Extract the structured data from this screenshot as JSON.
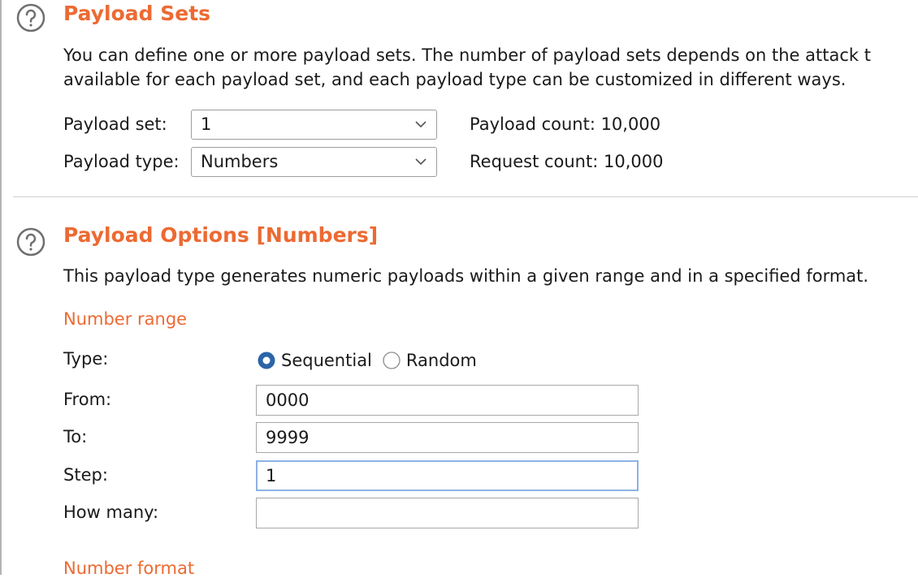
{
  "payload_sets": {
    "title": "Payload Sets",
    "description_line1": "You can define one or more payload sets. The number of payload sets depends on the attack t",
    "description_line2": "available for each payload set, and each payload type can be customized in different ways.",
    "payload_set_label": "Payload set:",
    "payload_set_value": "1",
    "payload_type_label": "Payload type:",
    "payload_type_value": "Numbers",
    "payload_count": "Payload count: 10,000",
    "request_count": "Request count: 10,000"
  },
  "payload_options": {
    "title": "Payload Options [Numbers]",
    "description": "This payload type generates numeric payloads within a given range and in a specified format.",
    "number_range_heading": "Number range",
    "type_label": "Type:",
    "type_options": [
      "Sequential",
      "Random"
    ],
    "type_selected": "Sequential",
    "from_label": "From:",
    "from_value": "0000",
    "to_label": "To:",
    "to_value": "9999",
    "step_label": "Step:",
    "step_value": "1",
    "how_many_label": "How many:",
    "how_many_value": "",
    "number_format_heading": "Number format"
  },
  "colors": {
    "accent": "#ec6a33",
    "radio_selected": "#2b65a7",
    "focus_border": "#8db2e3"
  },
  "icons": [
    "help-icon",
    "chevron-down-icon"
  ]
}
